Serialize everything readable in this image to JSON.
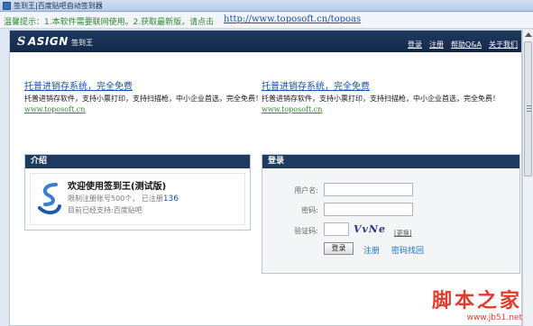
{
  "window": {
    "title": "签到王|百度贴吧自动签到器"
  },
  "notice": {
    "text": "温馨提示：1.本软件需要联网使用。2.获取最新版，请点击",
    "url": "http://www.toposoft.cn/topoas"
  },
  "header": {
    "logo_mark": "S",
    "logo_word": "ASIGN",
    "logo_sub": "签到王",
    "nav": [
      "登录",
      "注册",
      "帮助Q&A",
      "关于我们"
    ]
  },
  "ads": [
    {
      "title": "托普进销存系统，完全免费",
      "desc": "托普进销存软件，支持小票打印，支持扫描枪，中小企业首选，完全免费！",
      "url": "www.toposoft.cn"
    },
    {
      "title": "托普进销存系统，完全免费",
      "desc": "托普进销存软件，支持小票打印，支持扫描枪，中小企业首选，完全免费！",
      "url": "www.toposoft.cn"
    }
  ],
  "intro": {
    "heading": "介绍",
    "welcome": "欢迎使用签到王(测试版)",
    "limit_text": "限制注册账号500个，",
    "registered_label": "已注册",
    "registered_count": "136",
    "support_text": "目前已经支持:百度贴吧"
  },
  "login": {
    "heading": "登录",
    "username_label": "用户名:",
    "password_label": "密码:",
    "captcha_label": "验证码:",
    "captcha_text": "VvNe",
    "refresh_label": "[更换]",
    "submit_label": "登录",
    "register_link": "注册",
    "recover_link": "密码找回"
  },
  "watermark": {
    "big": "脚本之家",
    "small": "www.jb51.net"
  },
  "colors": {
    "header_bg": "#1e3a5f",
    "link": "#1a4fb0",
    "notice_green": "#2f8a2f",
    "watermark_red": "#e23a2e"
  }
}
